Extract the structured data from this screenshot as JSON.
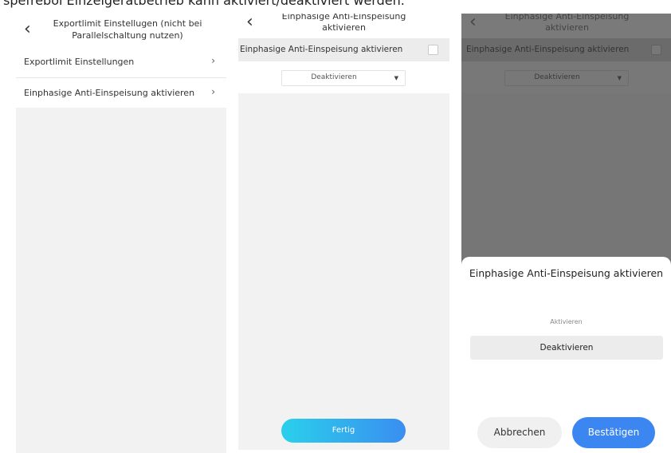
{
  "caption": "spefrebol Einzelgerätbetrieb kann aktiviert/deaktiviert werden.",
  "screen1": {
    "title": "Exportlimit Einstellugen (nicht bei Parallelschaltung nutzen)",
    "items": [
      {
        "label": "Exportlimit Einstellungen"
      },
      {
        "label": "Einphasige Anti-Einspeisung aktivieren"
      }
    ]
  },
  "screen2": {
    "title": "Einphasige Anti-Einspeisung aktivieren",
    "checkbox_label": "Einphasige Anti-Einspeisung aktivieren",
    "dropdown_value": "Deaktivieren",
    "done_label": "Fertig"
  },
  "screen3": {
    "title": "Einphasige Anti-Einspeisung aktivieren",
    "checkbox_label": "Einphasige Anti-Einspeisung aktivieren",
    "dropdown_value": "Deaktivieren",
    "sheet": {
      "title": "Einphasige Anti-Einspeisung aktivieren",
      "options": [
        "Aktivieren",
        "Deaktivieren"
      ],
      "selected": "Deaktivieren",
      "cancel_label": "Abbrechen",
      "confirm_label": "Bestätigen"
    }
  },
  "icons": {
    "back": "chevron-left-icon",
    "row_arrow": "chevron-right-icon",
    "dropdown_arrow": "caret-down-icon"
  },
  "colors": {
    "accent_blue": "#3b86f0",
    "gradient_start": "#2ad0ec",
    "overlay_gray": "#767676"
  }
}
